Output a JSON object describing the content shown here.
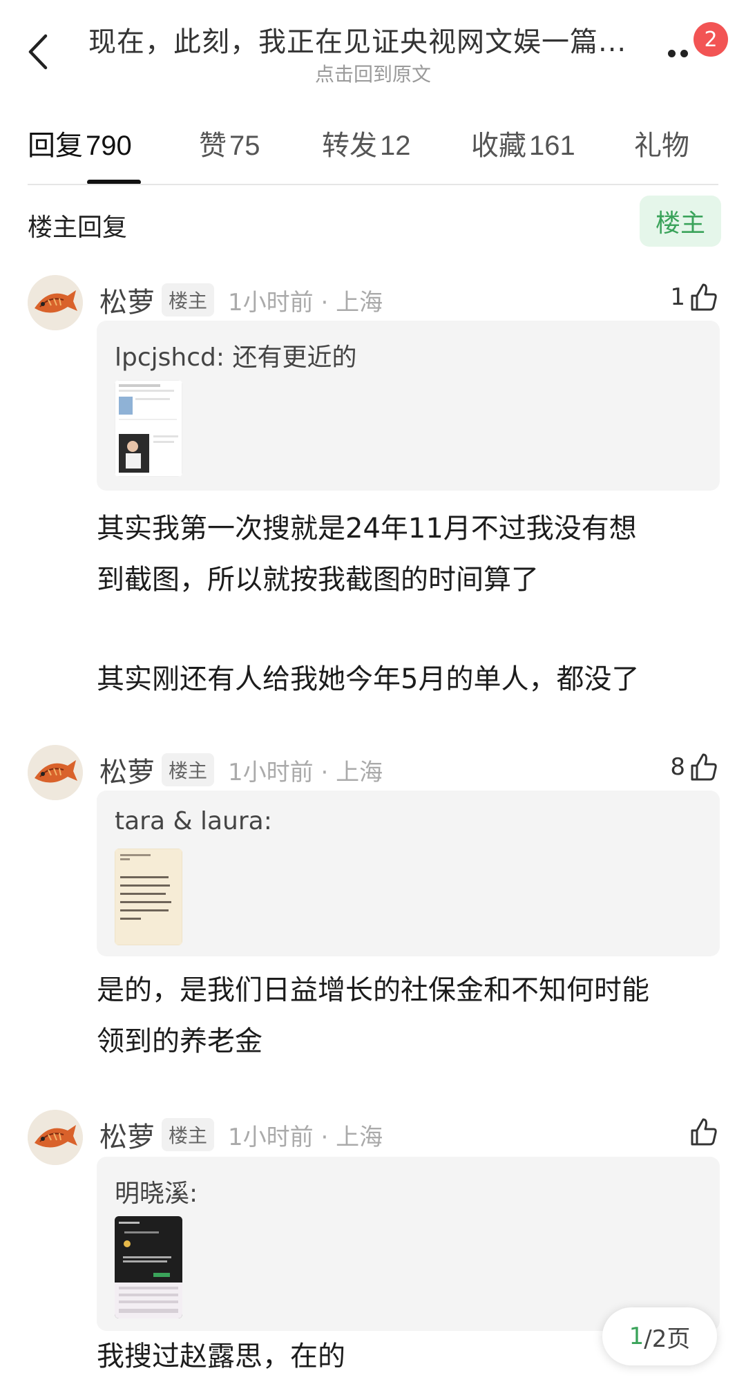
{
  "header": {
    "title": "现在，此刻，我正在见证央视网文娱一篇...",
    "subtitle": "点击回到原文",
    "notification_count": "2"
  },
  "tabs": [
    {
      "label": "回复",
      "count": "790",
      "active": true
    },
    {
      "label": "赞",
      "count": "75"
    },
    {
      "label": "转发",
      "count": "12"
    },
    {
      "label": "收藏",
      "count": "161"
    },
    {
      "label": "礼物",
      "count": ""
    }
  ],
  "section": {
    "title": "楼主回复",
    "filter_label": "楼主"
  },
  "replies": [
    {
      "username": "松萝",
      "tag": "楼主",
      "time": "1小时前 · 上海",
      "likes": "1",
      "quote_author": "lpcjshcd",
      "quote_text": "lpcjshcd: 还有更近的",
      "body": [
        "其实我第一次搜就是24年11月不过我没有想",
        "到截图，所以就按我截图的时间算了",
        "",
        "其实刚还有人给我她今年5月的单人，都没了"
      ]
    },
    {
      "username": "松萝",
      "tag": "楼主",
      "time": "1小时前 · 上海",
      "likes": "8",
      "quote_text": "tara & laura:",
      "body": [
        "是的，是我们日益增长的社保金和不知何时能",
        "领到的养老金"
      ]
    },
    {
      "username": "松萝",
      "tag": "楼主",
      "time": "1小时前 · 上海",
      "likes": "",
      "quote_text": "明晓溪:",
      "body": [
        "我搜过赵露思，在的"
      ]
    }
  ],
  "pager": {
    "current": "1",
    "total": "/2页"
  },
  "colors": {
    "accent_green": "#3aa35a",
    "badge_red": "#f25454",
    "quote_bg": "#f4f4f4"
  }
}
